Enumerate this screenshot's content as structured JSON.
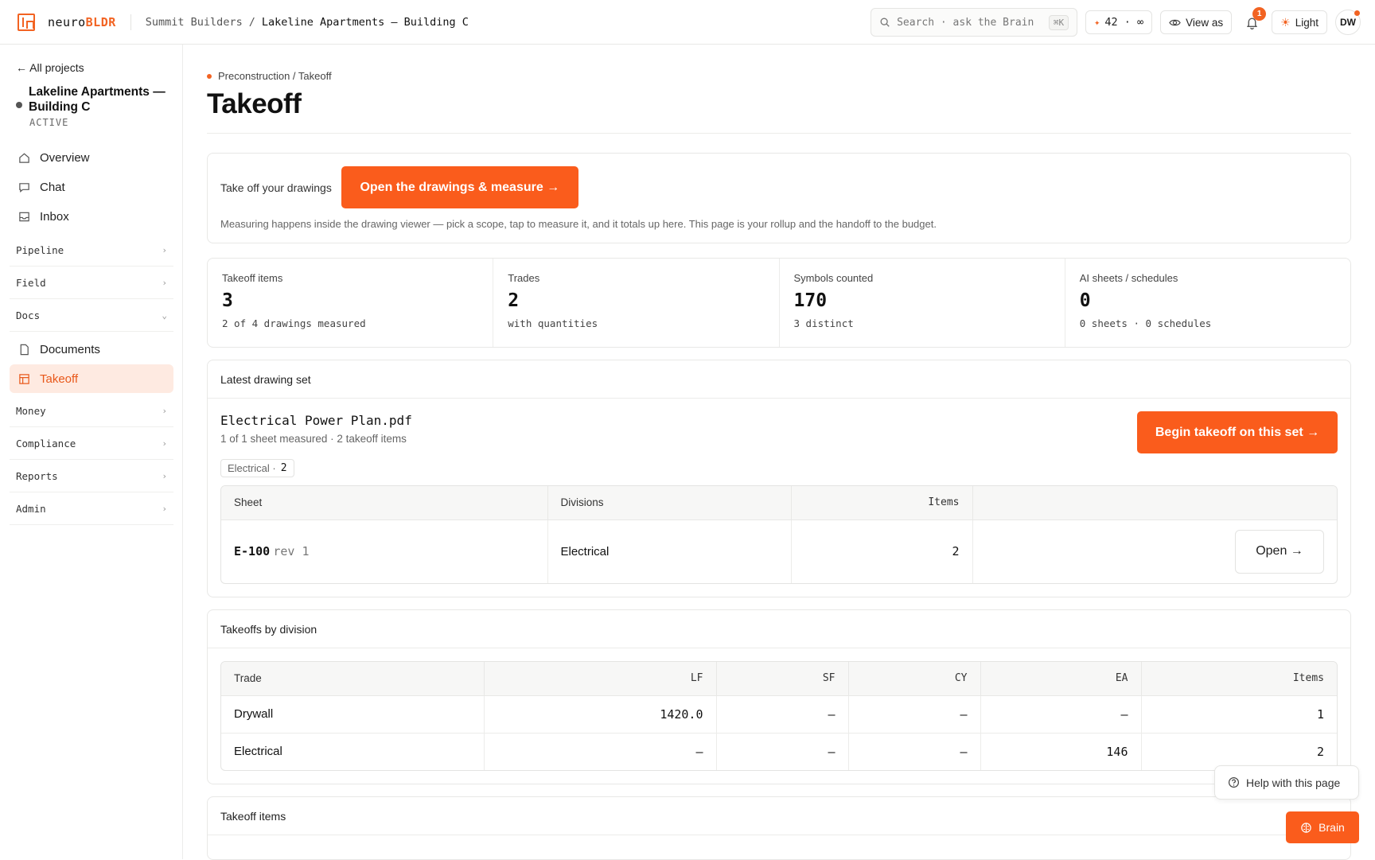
{
  "app": {
    "logo_prefix": "neuro",
    "logo_suffix": "BLDR"
  },
  "breadcrumb": {
    "org": "Summit Builders",
    "separator": "/",
    "project": "Lakeline Apartments — Building C"
  },
  "topbar": {
    "search_placeholder": "Search · ask the Brain",
    "search_shortcut": "⌘K",
    "credits": "42 · ∞",
    "view_as": "View as",
    "notifications_count": "1",
    "theme": "Light",
    "user_initials": "DW"
  },
  "sidebar": {
    "back": "← All projects",
    "project_name": "Lakeline Apartments — Building C",
    "project_status": "ACTIVE",
    "items": [
      {
        "label": "Overview",
        "icon": "home-icon"
      },
      {
        "label": "Chat",
        "icon": "chat-icon"
      },
      {
        "label": "Inbox",
        "icon": "inbox-icon"
      }
    ],
    "sections": {
      "pipeline": "Pipeline",
      "field": "Field",
      "docs": "Docs",
      "money": "Money",
      "compliance": "Compliance",
      "reports": "Reports",
      "admin": "Admin"
    },
    "docs_items": [
      {
        "label": "Documents",
        "icon": "document-icon"
      },
      {
        "label": "Takeoff",
        "icon": "takeoff-icon",
        "active": true
      }
    ]
  },
  "page": {
    "breadcrumb": "Preconstruction / Takeoff",
    "title": "Takeoff"
  },
  "cta": {
    "label": "Take off your drawings",
    "button": "Open the drawings & measure →",
    "note": "Measuring happens inside the drawing viewer — pick a scope, tap to measure it, and it totals up here. This page is your rollup and the handoff to the budget."
  },
  "stats": [
    {
      "label": "Takeoff items",
      "value": "3",
      "sub": "2 of 4 drawings measured"
    },
    {
      "label": "Trades",
      "value": "2",
      "sub": "with quantities"
    },
    {
      "label": "Symbols counted",
      "value": "170",
      "sub": "3 distinct"
    },
    {
      "label": "AI sheets / schedules",
      "value": "0",
      "sub": "0 sheets · 0 schedules"
    }
  ],
  "drawing_set": {
    "heading": "Latest drawing set",
    "file": "Electrical Power Plan.pdf",
    "meta": "1 of 1 sheet measured · 2 takeoff items",
    "chip_label": "Electrical ·",
    "chip_count": "2",
    "button": "Begin takeoff on this set →",
    "columns": {
      "sheet": "Sheet",
      "divisions": "Divisions",
      "items": "Items"
    },
    "rows": [
      {
        "sheet": "E-100",
        "rev": "rev 1",
        "divisions": "Electrical",
        "items": "2",
        "action": "Open →"
      }
    ]
  },
  "by_division": {
    "heading": "Takeoffs by division",
    "columns": {
      "trade": "Trade",
      "lf": "LF",
      "sf": "SF",
      "cy": "CY",
      "ea": "EA",
      "items": "Items"
    },
    "rows": [
      {
        "trade": "Drywall",
        "lf": "1420.0",
        "sf": "–",
        "cy": "–",
        "ea": "–",
        "items": "1"
      },
      {
        "trade": "Electrical",
        "lf": "–",
        "sf": "–",
        "cy": "–",
        "ea": "146",
        "items": "2"
      }
    ]
  },
  "takeoff_items": {
    "heading": "Takeoff items"
  },
  "floating": {
    "help": "Help with this page",
    "brain": "Brain"
  },
  "colors": {
    "accent": "#fa5c1c",
    "active_bg": "#feeae1"
  }
}
